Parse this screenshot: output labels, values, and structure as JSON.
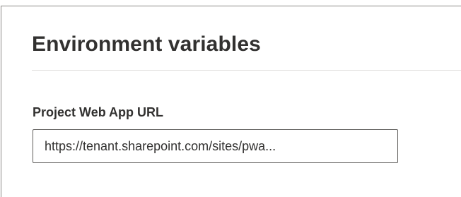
{
  "section": {
    "title": "Environment variables"
  },
  "fields": [
    {
      "label": "Project Web App URL",
      "value": "https://tenant.sharepoint.com/sites/pwa..."
    }
  ]
}
